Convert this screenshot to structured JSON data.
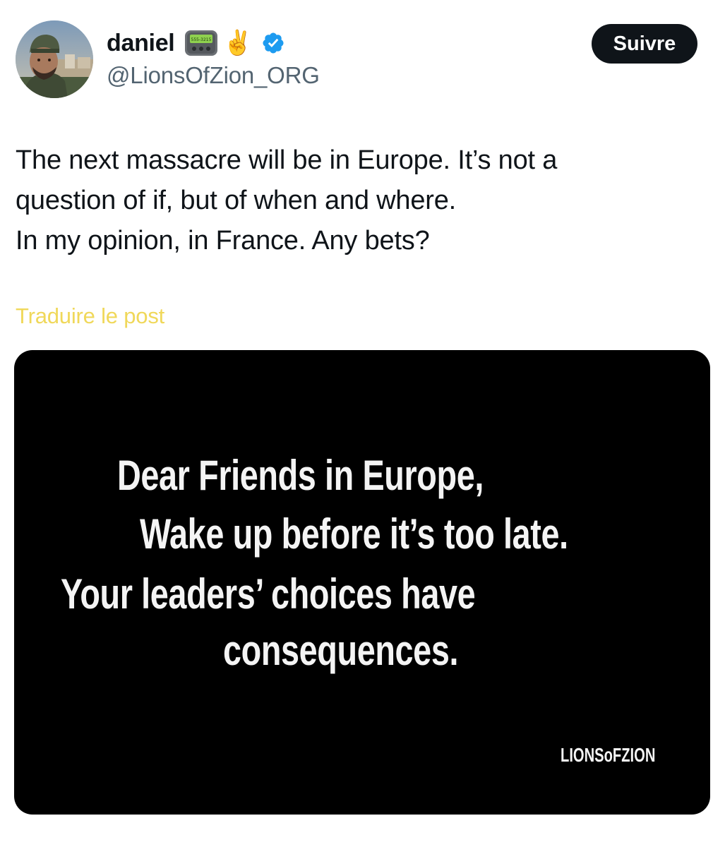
{
  "author": {
    "display_name": "daniel",
    "handle": "@LionsOfZion_ORG",
    "pager_text": "555-3215",
    "victory_emoji": "✌️",
    "verified": true,
    "verified_color": "#1d9bf0"
  },
  "follow_button": {
    "label": "Suivre"
  },
  "post": {
    "text_lines": [
      "The next massacre will be in Europe. It’s not a",
      "question of if, but of when and where.",
      "In my opinion, in France. Any bets?"
    ],
    "translate_label": "Traduire le post",
    "translate_color": "#f0d85a"
  },
  "media": {
    "lines": [
      "Dear Friends in Europe,",
      "Wake up before it’s too late.",
      "Your leaders’ choices have",
      "consequences."
    ],
    "watermark": "LIONSoFZION"
  }
}
